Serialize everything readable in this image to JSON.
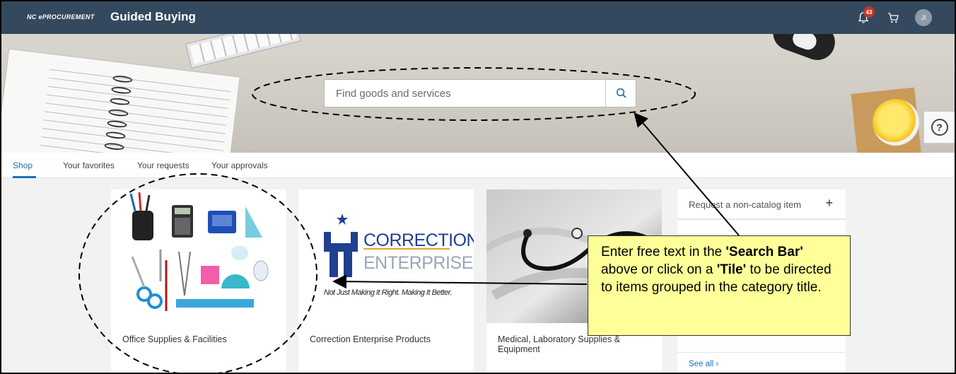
{
  "header": {
    "brand_small": "NC ePROCUREMENT",
    "app_title": "Guided Buying",
    "notification_count": "43",
    "avatar_initials": "JI",
    "bar_color": "#34495e"
  },
  "search": {
    "placeholder": "Find goods and services"
  },
  "help": {
    "label": "?"
  },
  "tabs": [
    {
      "label": "Shop",
      "active": true
    },
    {
      "label": "Your favorites"
    },
    {
      "label": "Your requests"
    },
    {
      "label": "Your approvals"
    }
  ],
  "tiles": [
    {
      "label": "Office Supplies & Facilities"
    },
    {
      "label": "Correction Enterprise Products",
      "logo_line1": "CORRECTION",
      "logo_line2": "ENTERPRISES",
      "tagline": "Not Just Making It Right. Making It Better."
    },
    {
      "label": "Medical, Laboratory Supplies & Equipment"
    }
  ],
  "side_panel": {
    "items": [
      {
        "label": "Request a non-catalog item",
        "icon": "plus-icon"
      }
    ],
    "see_all": "See all"
  },
  "callout": {
    "t1": "Enter free text in the ",
    "b1": "'Search Bar'",
    "t2": " above or click on a ",
    "b2": "'Tile'",
    "t3": " to be directed to items grouped in the category title."
  },
  "colors": {
    "accent": "#1f6fb2",
    "callout_bg": "#ffff99",
    "badge": "#c0392b"
  }
}
